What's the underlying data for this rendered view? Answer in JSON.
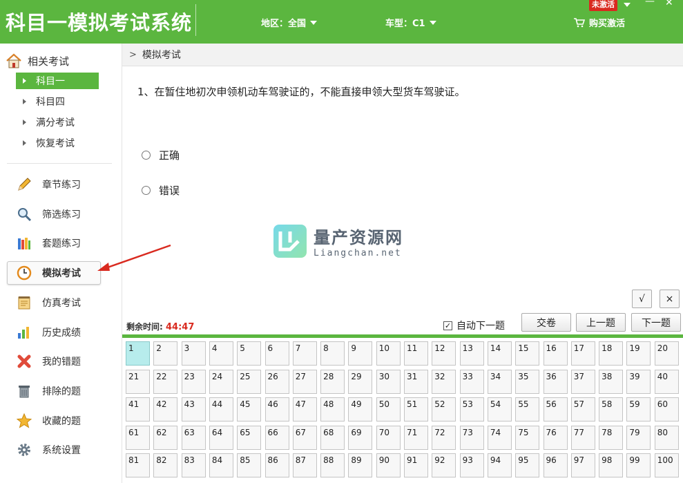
{
  "header": {
    "app_title": "科目一模拟考试系统",
    "region_label": "地区：全国",
    "car_type_label": "车型：C1",
    "buy_label": "购买激活",
    "badge": "未激活",
    "accent_color": "#5bb63f"
  },
  "sidebar": {
    "section_title": "相关考试",
    "sub_items": [
      {
        "label": "科目一",
        "active": true
      },
      {
        "label": "科目四",
        "active": false
      },
      {
        "label": "满分考试",
        "active": false
      },
      {
        "label": "恢复考试",
        "active": false
      }
    ],
    "nav_items": [
      {
        "label": "章节练习",
        "icon": "pencil-icon"
      },
      {
        "label": "筛选练习",
        "icon": "magnifier-icon"
      },
      {
        "label": "套题练习",
        "icon": "books-icon"
      },
      {
        "label": "模拟考试",
        "icon": "clock-icon",
        "active": true
      },
      {
        "label": "仿真考试",
        "icon": "notepad-icon"
      },
      {
        "label": "历史成绩",
        "icon": "bar-chart-icon"
      },
      {
        "label": "我的错题",
        "icon": "red-x-icon"
      },
      {
        "label": "排除的题",
        "icon": "trash-icon"
      },
      {
        "label": "收藏的题",
        "icon": "star-icon"
      },
      {
        "label": "系统设置",
        "icon": "gear-icon"
      }
    ]
  },
  "main": {
    "breadcrumb": "模拟考试",
    "question": "1、在暂住地初次申领机动车驾驶证的，不能直接申领大型货车驾驶证。",
    "options": [
      "正确",
      "错误"
    ],
    "watermark": {
      "title": "量产资源网",
      "subtitle": "Liangchan.net"
    },
    "check_button": "√",
    "cross_button": "×",
    "timer_label": "剩余时间:",
    "timer_value": "44:47",
    "auto_next_label": "自动下一题",
    "auto_next_checked": true,
    "submit_label": "交卷",
    "prev_label": "上一题",
    "next_label": "下一题",
    "current_question": 1,
    "question_count": 100
  }
}
